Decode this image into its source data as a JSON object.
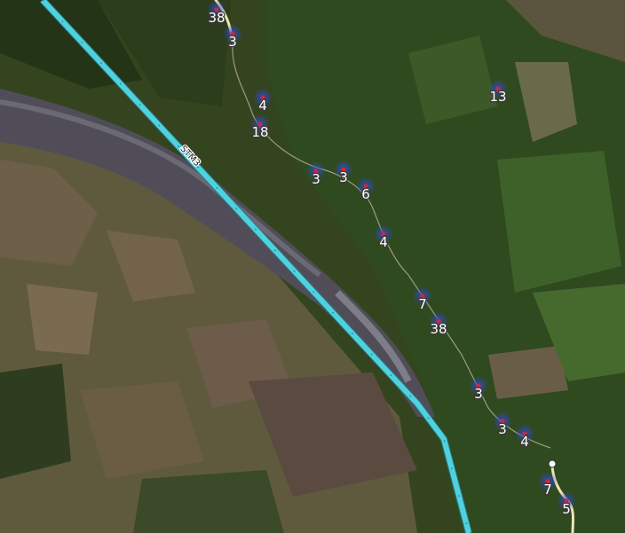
{
  "map": {
    "route": {
      "name": "STM3",
      "color": "#4fd2de"
    },
    "trail": {
      "color": "#eee3b4"
    },
    "cluster_colors": {
      "halo": "#2f4bd6",
      "core": "#d8242e"
    },
    "clusters": [
      {
        "count": "38"
      },
      {
        "count": "3"
      },
      {
        "count": "4"
      },
      {
        "count": "18"
      },
      {
        "count": "3"
      },
      {
        "count": "3"
      },
      {
        "count": "6"
      },
      {
        "count": "4"
      },
      {
        "count": "7"
      },
      {
        "count": "38"
      },
      {
        "count": "3"
      },
      {
        "count": "3"
      },
      {
        "count": "4"
      },
      {
        "count": "7"
      },
      {
        "count": "5"
      },
      {
        "count": "13"
      }
    ]
  }
}
